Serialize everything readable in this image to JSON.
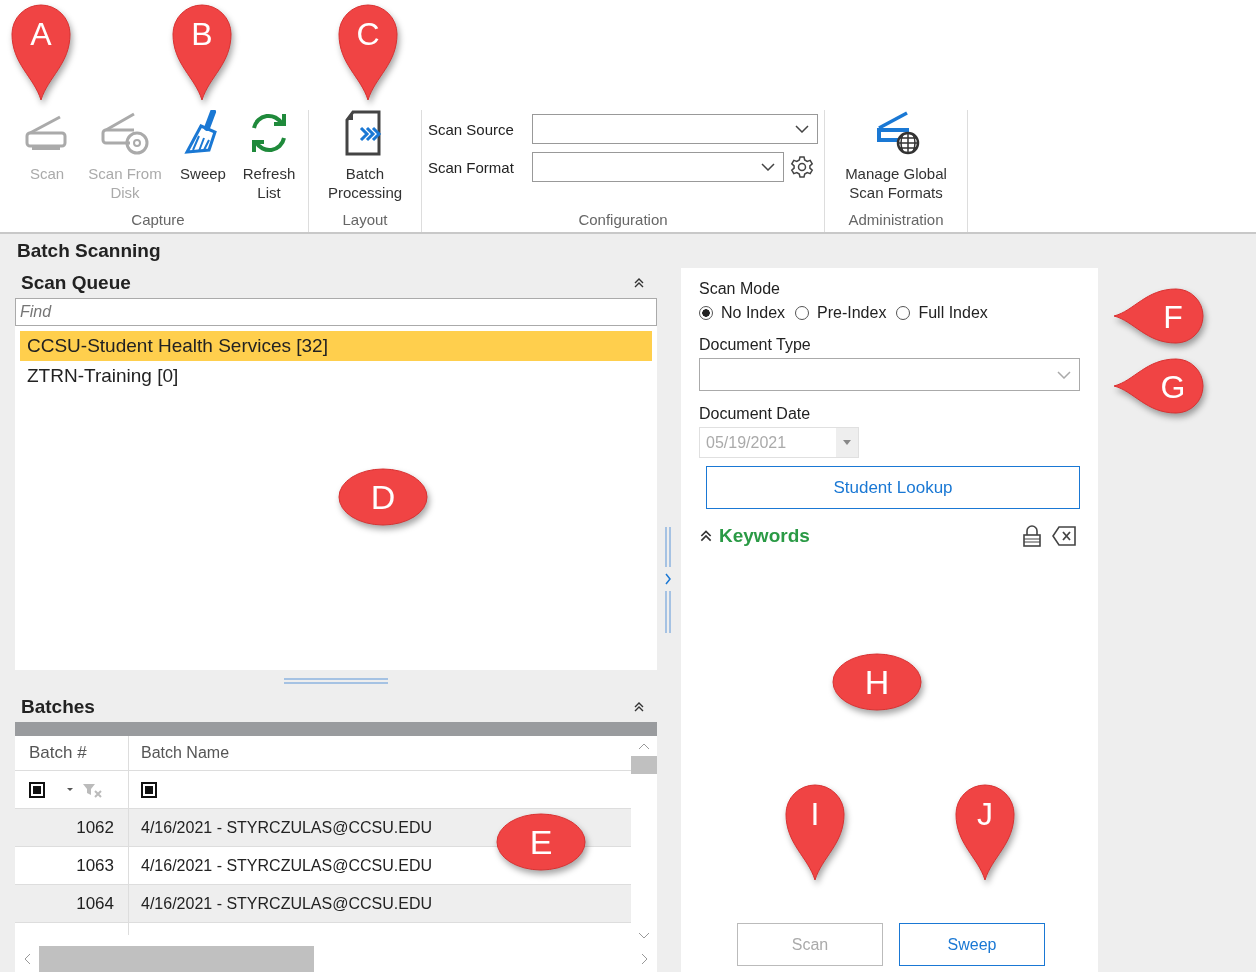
{
  "ribbon": {
    "groups": [
      {
        "label": "Capture",
        "buttons": [
          {
            "label": "Scan",
            "disabled": true
          },
          {
            "label": "Scan From Disk",
            "disabled": true
          },
          {
            "label": "Sweep",
            "disabled": false
          },
          {
            "label": "Refresh List",
            "disabled": false
          }
        ]
      },
      {
        "label": "Layout",
        "buttons": [
          {
            "label": "Batch Processing",
            "disabled": false
          }
        ]
      },
      {
        "label": "Configuration",
        "combos": [
          {
            "label": "Scan Source"
          },
          {
            "label": "Scan Format"
          }
        ]
      },
      {
        "label": "Administration",
        "buttons": [
          {
            "label": "Manage Global Scan Formats",
            "disabled": false
          }
        ]
      }
    ]
  },
  "title": "Batch Scanning",
  "scan_queue": {
    "title": "Scan Queue",
    "find": {
      "placeholder": "Find"
    },
    "items": [
      {
        "label": "CCSU-Student Health Services [32]",
        "selected": true
      },
      {
        "label": "ZTRN-Training [0]",
        "selected": false
      }
    ]
  },
  "batches": {
    "title": "Batches",
    "columns": [
      "Batch #",
      "Batch Name"
    ],
    "filters": [
      {
        "checked": true
      },
      {
        "checked": true
      }
    ],
    "rows": [
      {
        "number": "1062",
        "name": "4/16/2021 - STYRCZULAS@CCSU.EDU",
        "shaded": true
      },
      {
        "number": "1063",
        "name": "4/16/2021 - STYRCZULAS@CCSU.EDU",
        "shaded": false
      },
      {
        "number": "1064",
        "name": "4/16/2021 - STYRCZULAS@CCSU.EDU",
        "shaded": true
      }
    ]
  },
  "scan_mode": {
    "label": "Scan Mode",
    "options": [
      {
        "label": "No Index",
        "selected": true
      },
      {
        "label": "Pre-Index",
        "selected": false
      },
      {
        "label": "Full Index",
        "selected": false
      }
    ]
  },
  "document_type": {
    "label": "Document Type"
  },
  "document_date": {
    "label": "Document Date",
    "value": "05/19/2021",
    "disabled": true
  },
  "student_lookup": "Student Lookup",
  "keywords": "Keywords",
  "actions": [
    {
      "label": "Scan",
      "disabled": true
    },
    {
      "label": "Sweep",
      "disabled": false
    }
  ],
  "callouts": [
    {
      "letter": "A",
      "kind": "pin-down"
    },
    {
      "letter": "B",
      "kind": "pin-down"
    },
    {
      "letter": "C",
      "kind": "pin-down"
    },
    {
      "letter": "D",
      "kind": "oval"
    },
    {
      "letter": "E",
      "kind": "oval"
    },
    {
      "letter": "F",
      "kind": "pin-left"
    },
    {
      "letter": "G",
      "kind": "pin-left"
    },
    {
      "letter": "H",
      "kind": "oval"
    },
    {
      "letter": "I",
      "kind": "pin-down"
    },
    {
      "letter": "J",
      "kind": "pin-down"
    }
  ]
}
